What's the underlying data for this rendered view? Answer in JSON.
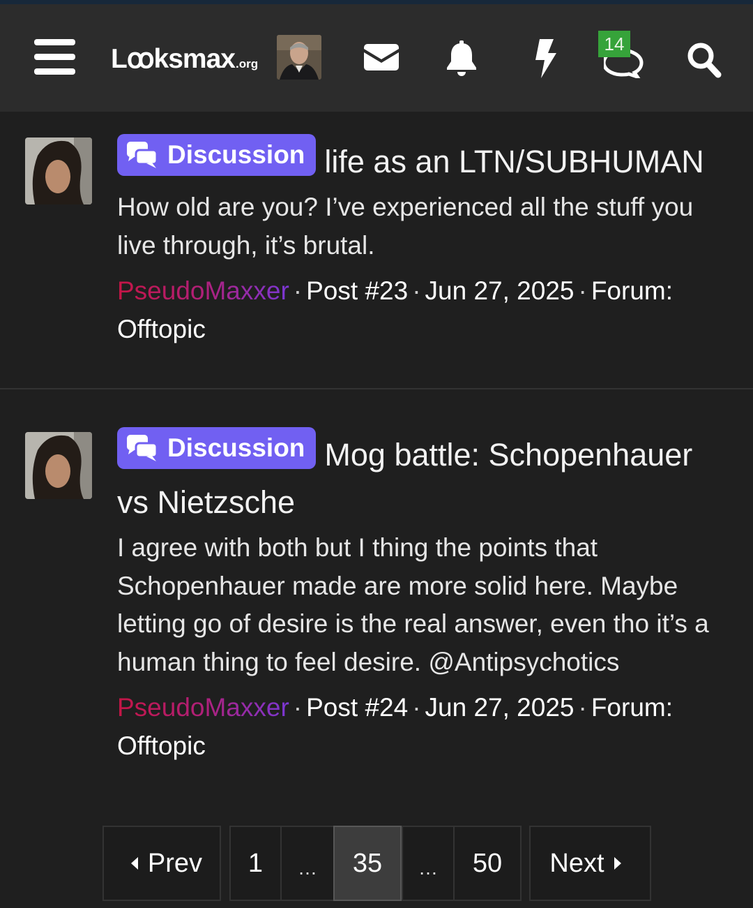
{
  "header": {
    "logo_main": "Lꝏksmax",
    "logo_tld": ".org",
    "conversations_badge": "14",
    "icons": [
      "menu-icon",
      "mail-icon",
      "bell-icon",
      "bolt-icon",
      "conversations-icon",
      "search-icon"
    ]
  },
  "results": [
    {
      "label": "Discussion",
      "title": "life as an LTN/SUBHUMAN",
      "snippet": "How old are you? I’ve experienced all the stuff you live through, it’s brutal.",
      "author": "PseudoMaxxer",
      "post": "Post #23",
      "date": "Jun 27, 2025",
      "forum_prefix": "Forum:",
      "forum": "Offtopic"
    },
    {
      "label": "Discussion",
      "title": "Mog battle: Schopenhauer vs Nietzsche",
      "snippet": "I agree with both but I thing the points that Schopenhauer made are more solid here. Maybe letting go of desire is the real answer, even tho it’s a human thing to feel desire. @Antipsychotics",
      "author": "PseudoMaxxer",
      "post": "Post #24",
      "date": "Jun 27, 2025",
      "forum_prefix": "Forum:",
      "forum": "Offtopic"
    }
  ],
  "pagination": {
    "prev": "Prev",
    "first": "1",
    "ellipsis": "…",
    "current": "35",
    "last": "50",
    "next": "Next"
  },
  "colors": {
    "label_bg": "#7160f2",
    "badge_bg": "#36a33a",
    "username_start": "#c41545",
    "username_end": "#7a37d6"
  }
}
